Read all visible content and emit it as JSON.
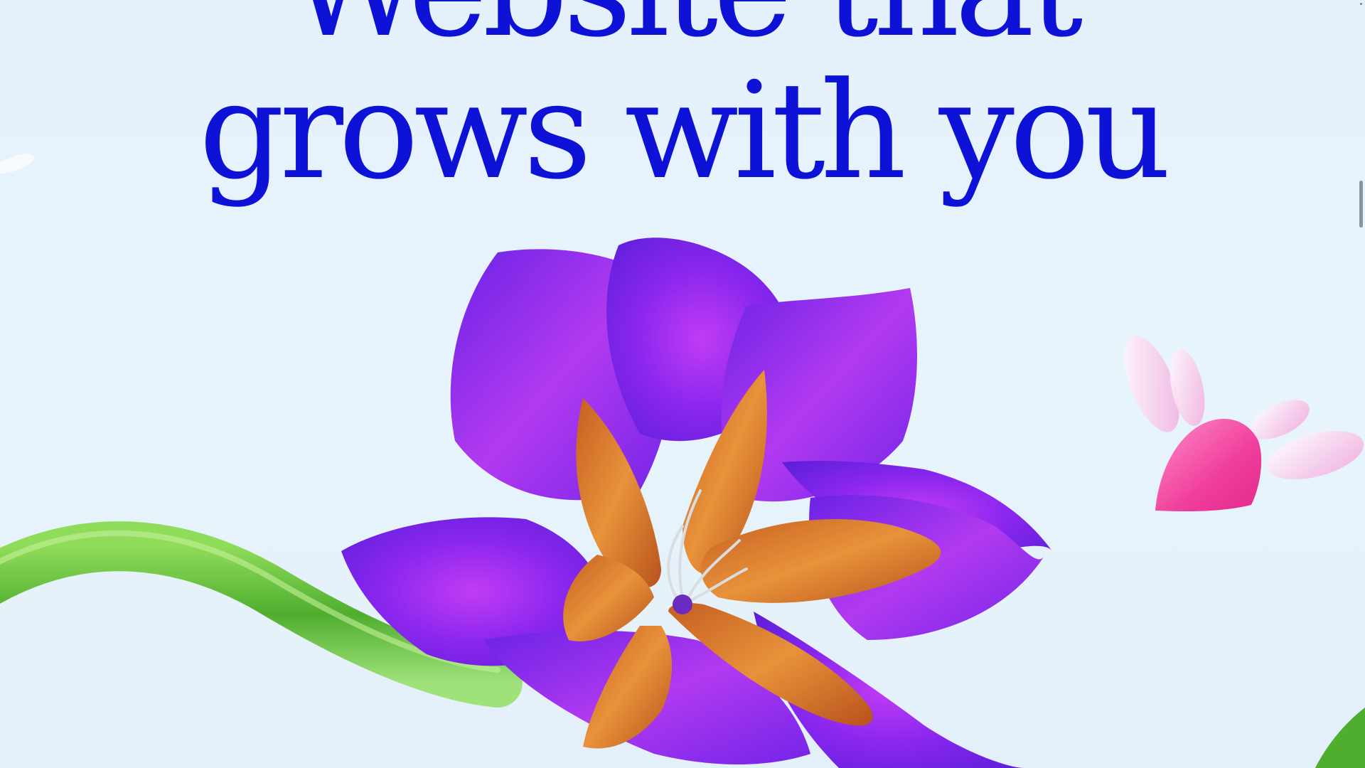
{
  "hero": {
    "headline_line1": "Website that",
    "headline_line2": "grows with you"
  },
  "colors": {
    "background": "#e6f2fb",
    "headline": "#0d12d6",
    "petal_purple": "#7a1ff0",
    "petal_orange": "#d8762c",
    "stem_green": "#5fbf3a",
    "heart_pink": "#f24fa6"
  },
  "icons": {
    "flower": "purple-flower-illustration",
    "stem": "green-stem-illustration",
    "flying_heart": "winged-heart-illustration"
  }
}
